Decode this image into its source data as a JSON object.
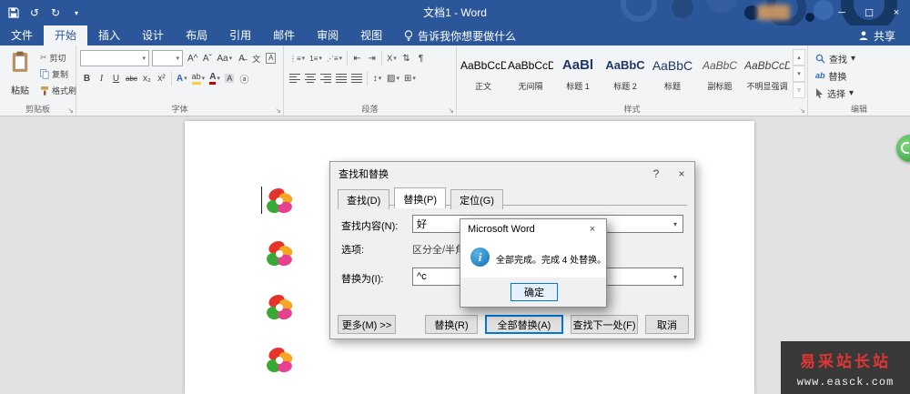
{
  "app": {
    "title": "文档1 - Word"
  },
  "icons": {
    "undo": "↺",
    "redo": "↻",
    "qat_arrow": "▾",
    "minimize": "─",
    "maximize": "☐",
    "close": "×",
    "cut": "✂",
    "dropdown": "▾",
    "grow_font": "A^",
    "shrink_font": "Aˇ",
    "change_case": "Aa",
    "clear_format": "A̶",
    "phonetic": "文",
    "char_border": "A",
    "bold": "B",
    "italic": "I",
    "underline": "U",
    "strikethrough": "abc",
    "subscript": "x₂",
    "superscript": "x²",
    "text_effects": "A",
    "highlight": "ab",
    "font_color": "A",
    "char_shading": "A",
    "enclose": "ⓐ",
    "bullets": "⋮≡",
    "numbering": "1≡",
    "multilevel": "⋰≡",
    "outdent": "⇤",
    "indent": "⇥",
    "asian_layout": "X",
    "sort": "⇅",
    "pilcrow": "¶",
    "line_spacing": "↕",
    "shading": "▨",
    "borders": "⊞",
    "launcher": "↘",
    "styles_scroll_up": "▴",
    "styles_scroll_down": "▾",
    "styles_more": "▿",
    "help": "?",
    "info": "i"
  },
  "tabs": {
    "file": "文件",
    "items": [
      "开始",
      "插入",
      "设计",
      "布局",
      "引用",
      "邮件",
      "审阅",
      "视图"
    ],
    "tellme": "告诉我你想要做什么",
    "share": "共享"
  },
  "ribbon": {
    "clipboard": {
      "label": "剪贴板",
      "paste": "粘贴",
      "cut": "剪切",
      "copy": "复制",
      "format_painter": "格式刷"
    },
    "font": {
      "label": "字体"
    },
    "paragraph": {
      "label": "段落"
    },
    "styles": {
      "label": "样式",
      "items": [
        {
          "sample": "AaBbCcD",
          "name": "正文"
        },
        {
          "sample": "AaBbCcD",
          "name": "无间隔"
        },
        {
          "sample": "AaBl",
          "name": "标题 1"
        },
        {
          "sample": "AaBbC",
          "name": "标题 2"
        },
        {
          "sample": "AaBbC",
          "name": "标题"
        },
        {
          "sample": "AaBbC",
          "name": "副标题"
        },
        {
          "sample": "AaBbCcD",
          "name": "不明显强调"
        }
      ]
    },
    "editing": {
      "label": "编辑",
      "find": "查找",
      "replace": "替换",
      "select": "选择"
    }
  },
  "dialog": {
    "title": "查找和替换",
    "tabs": [
      "查找(D)",
      "替换(P)",
      "定位(G)"
    ],
    "find_label": "查找内容(N):",
    "find_value": "好",
    "options_label": "选项:",
    "options_value": "区分全/半角",
    "replace_label": "替换为(I):",
    "replace_value": "^c",
    "more_button": "更多(M) >>",
    "replace_button": "替换(R)",
    "replace_all_button": "全部替换(A)",
    "find_next_button": "查找下一处(F)",
    "cancel_button": "取消"
  },
  "msgbox": {
    "title": "Microsoft Word",
    "message": "全部完成。完成 4 处替换。",
    "ok_button": "确定"
  },
  "watermark": {
    "line1": "易采站长站",
    "line2": "www.easck.com"
  }
}
